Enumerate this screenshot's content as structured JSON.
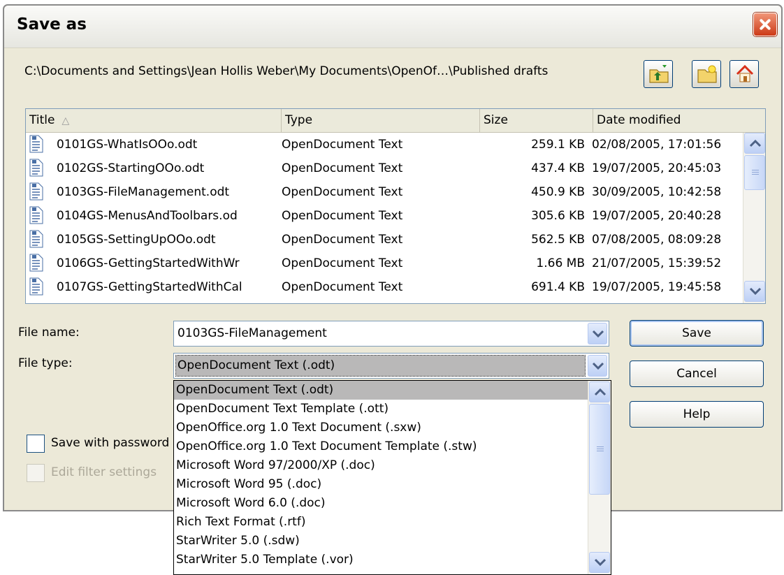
{
  "window": {
    "title": "Save as"
  },
  "path": "C:\\Documents and Settings\\Jean Hollis Weber\\My Documents\\OpenOf…\\Published drafts",
  "toolbar": [
    {
      "name": "up-one-level-button",
      "icon": "folder-up-icon"
    },
    {
      "name": "create-new-folder-button",
      "icon": "new-folder-icon"
    },
    {
      "name": "default-directory-button",
      "icon": "home-icon"
    }
  ],
  "columns": [
    {
      "label": "Title",
      "sort": "ascending"
    },
    {
      "label": "Type"
    },
    {
      "label": "Size"
    },
    {
      "label": "Date modified"
    }
  ],
  "files": [
    {
      "name": "0101GS-WhatIsOOo.odt",
      "type": "OpenDocument Text",
      "size": "259.1 KB",
      "date": "02/08/2005, 17:01:56"
    },
    {
      "name": "0102GS-StartingOOo.odt",
      "type": "OpenDocument Text",
      "size": "437.4 KB",
      "date": "19/07/2005, 20:45:03"
    },
    {
      "name": "0103GS-FileManagement.odt",
      "type": "OpenDocument Text",
      "size": "450.9 KB",
      "date": "30/09/2005, 10:42:58"
    },
    {
      "name": "0104GS-MenusAndToolbars.od",
      "type": "OpenDocument Text",
      "size": "305.6 KB",
      "date": "19/07/2005, 20:40:28"
    },
    {
      "name": "0105GS-SettingUpOOo.odt",
      "type": "OpenDocument Text",
      "size": "562.5 KB",
      "date": "07/08/2005, 08:09:28"
    },
    {
      "name": "0106GS-GettingStartedWithWr",
      "type": "OpenDocument Text",
      "size": "1.66 MB",
      "date": "21/07/2005, 15:39:52"
    },
    {
      "name": "0107GS-GettingStartedWithCal",
      "type": "OpenDocument Text",
      "size": "691.4 KB",
      "date": "19/07/2005, 19:45:58"
    }
  ],
  "form": {
    "filename_label": "File name:",
    "filename_value": "0103GS-FileManagement",
    "filetype_label": "File type:",
    "filetype_value": "OpenDocument Text (.odt)",
    "save_password_label": "Save with password",
    "edit_filter_label": "Edit filter settings"
  },
  "buttons": {
    "save": "Save",
    "cancel": "Cancel",
    "help": "Help"
  },
  "filetype_options": [
    "OpenDocument Text (.odt)",
    "OpenDocument Text Template (.ott)",
    "OpenOffice.org 1.0 Text Document (.sxw)",
    "OpenOffice.org 1.0 Text Document Template (.stw)",
    "Microsoft Word 97/2000/XP (.doc)",
    "Microsoft Word 95 (.doc)",
    "Microsoft Word 6.0 (.doc)",
    "Rich Text Format (.rtf)",
    "StarWriter 5.0 (.sdw)",
    "StarWriter 5.0 Template (.vor)"
  ],
  "colors": {
    "accent": "#003c74",
    "selection": "#b9b8b8",
    "dialog_bg": "#ece9d8",
    "close_red": "#cc3a17"
  }
}
